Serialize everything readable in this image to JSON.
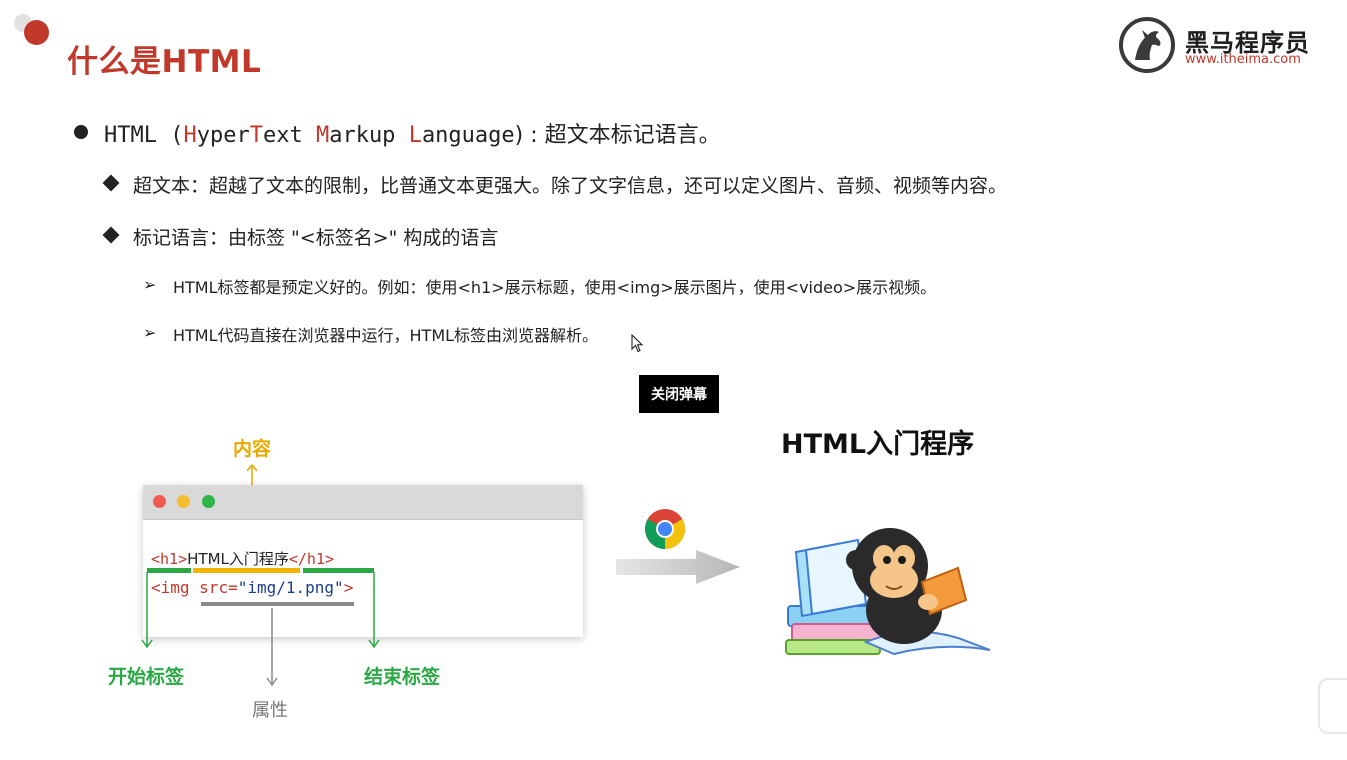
{
  "slide": {
    "title": "什么是HTML"
  },
  "logo": {
    "name": "黑马程序员",
    "url": "www.itheima.com"
  },
  "bullet1": {
    "prefix": "HTML (",
    "h": "H",
    "yper": "yper",
    "t": "T",
    "ext": "ext ",
    "m": "M",
    "arkup": "arkup ",
    "l": "L",
    "anguage": "anguage",
    "suffix": ") : 超文本标记语言。"
  },
  "sub1": "超文本：超越了文本的限制，比普通文本更强大。除了文字信息，还可以定义图片、音频、视频等内容。",
  "sub2": "标记语言：由标签 \"<标签名>\" 构成的语言",
  "detail1": "HTML标签都是预定义好的。例如：使用<h1>展示标题，使用<img>展示图片，使用<video>展示视频。",
  "detail2": "HTML代码直接在浏览器中运行，HTML标签由浏览器解析。",
  "tooltip": "关闭弹幕",
  "diagram": {
    "code_h1_open": "<h1>",
    "code_h1_text": "HTML入门程序",
    "code_h1_close": "</h1>",
    "code_img_open": "<img ",
    "code_img_attr": "src",
    "code_img_eq": "=",
    "code_img_val": "\"img/1.png\"",
    "code_img_close": ">",
    "label_content": "内容",
    "label_start": "开始标签",
    "label_end": "结束标签",
    "label_attr": "属性",
    "result_title": "HTML入门程序"
  },
  "colors": {
    "accent": "#c0392b",
    "content": "#e8a800",
    "tag": "#2aa845",
    "attr": "#777777"
  }
}
